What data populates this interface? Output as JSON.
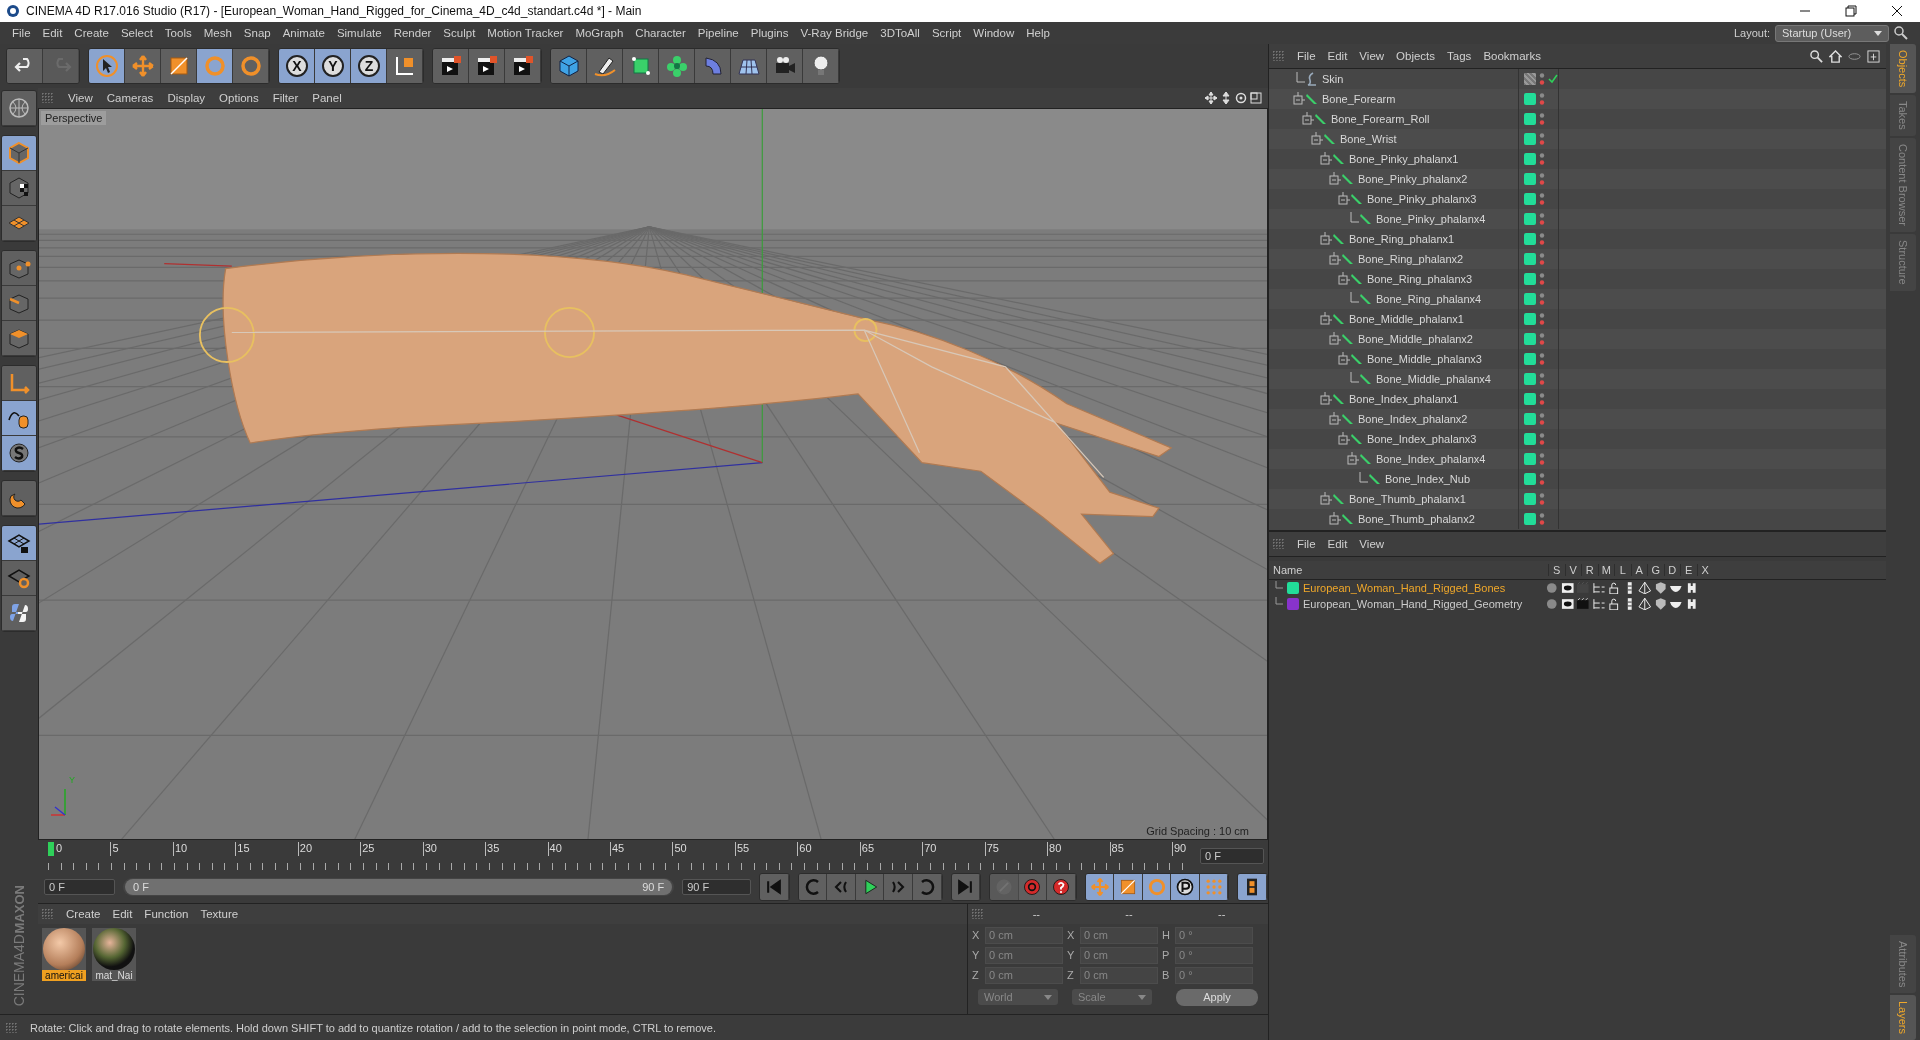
{
  "window": {
    "title": "CINEMA 4D R17.016 Studio (R17) - [European_Woman_Hand_Rigged_for_Cinema_4D_c4d_standart.c4d *] - Main"
  },
  "menu_bar": [
    "File",
    "Edit",
    "Create",
    "Select",
    "Tools",
    "Mesh",
    "Snap",
    "Animate",
    "Simulate",
    "Render",
    "Sculpt",
    "Motion Tracker",
    "MoGraph",
    "Character",
    "Pipeline",
    "Plugins",
    "V-Ray Bridge",
    "3DToAll",
    "Script",
    "Window",
    "Help"
  ],
  "layout": {
    "label": "Layout:",
    "value": "Startup (User)"
  },
  "toolbar": [
    [
      {
        "kind": "undo",
        "selected": false,
        "disabled": false
      },
      {
        "kind": "redo",
        "selected": false,
        "disabled": true
      }
    ],
    [
      {
        "kind": "cursor",
        "selected": true,
        "disabled": false
      },
      {
        "kind": "move",
        "selected": false,
        "disabled": false
      },
      {
        "kind": "scale",
        "selected": false,
        "disabled": false
      },
      {
        "kind": "rotate",
        "selected": true,
        "disabled": false
      },
      {
        "kind": "rotate",
        "selected": false,
        "disabled": false
      }
    ],
    [
      {
        "kind": "letter",
        "label": "X",
        "selected": true,
        "disabled": false
      },
      {
        "kind": "letter",
        "label": "Y",
        "selected": true,
        "disabled": false
      },
      {
        "kind": "letter",
        "label": "Z",
        "selected": true,
        "disabled": false
      },
      {
        "kind": "axes",
        "selected": false,
        "disabled": false
      }
    ],
    [
      {
        "kind": "clapper",
        "selected": false,
        "disabled": false
      },
      {
        "kind": "clapper",
        "selected": false,
        "disabled": false
      },
      {
        "kind": "clapper",
        "selected": false,
        "disabled": false
      }
    ],
    [
      {
        "kind": "cube",
        "selected": false,
        "disabled": false
      },
      {
        "kind": "pen",
        "selected": false,
        "disabled": false
      },
      {
        "kind": "greencube",
        "selected": false,
        "disabled": false
      },
      {
        "kind": "flower",
        "selected": false,
        "disabled": false
      },
      {
        "kind": "bend",
        "selected": false,
        "disabled": false
      },
      {
        "kind": "floor",
        "selected": false,
        "disabled": false
      },
      {
        "kind": "camera",
        "selected": false,
        "disabled": false
      },
      {
        "kind": "bulb",
        "selected": false,
        "disabled": false
      }
    ]
  ],
  "left_toolbar": [
    [
      {
        "kind": "globe",
        "selected": false
      }
    ],
    [
      {
        "kind": "model",
        "selected": true
      },
      {
        "kind": "checker",
        "selected": false
      },
      {
        "kind": "plane",
        "selected": false
      }
    ],
    [
      {
        "kind": "points",
        "selected": false
      },
      {
        "kind": "edges",
        "selected": false
      },
      {
        "kind": "polygons",
        "selected": false
      }
    ],
    [
      {
        "kind": "axis",
        "selected": false
      },
      {
        "kind": "tweak",
        "selected": true
      },
      {
        "kind": "snap",
        "selected": true
      }
    ],
    [
      {
        "kind": "magnet",
        "selected": false
      }
    ],
    [
      {
        "kind": "lockgrid",
        "selected": true
      },
      {
        "kind": "syncgrid",
        "selected": false
      },
      {
        "kind": "python",
        "selected": false
      }
    ]
  ],
  "brand": [
    "MAXON",
    "CINEMA4D"
  ],
  "viewport": {
    "menu": [
      "View",
      "Cameras",
      "Display",
      "Options",
      "Filter",
      "Panel"
    ],
    "camera_label": "Perspective",
    "grid_spacing": "Grid Spacing : 10 cm",
    "gizmo_label": "Y"
  },
  "timeline": {
    "labels": [
      "0",
      "5",
      "10",
      "15",
      "20",
      "25",
      "30",
      "35",
      "40",
      "45",
      "50",
      "55",
      "60",
      "65",
      "70",
      "75",
      "80",
      "85",
      "90"
    ],
    "current_frame": "0 F"
  },
  "transport": {
    "start": "0 F",
    "range_slider": {
      "start": "0 F",
      "end": "90 F",
      "level": 1
    },
    "end": "90 F",
    "buttons": [
      [
        {
          "kind": "first",
          "selected": false,
          "disabled": false
        }
      ],
      [
        {
          "kind": "prevkey",
          "selected": false,
          "disabled": false
        },
        {
          "kind": "prevframe",
          "selected": false,
          "disabled": false
        },
        {
          "kind": "play",
          "selected": false,
          "disabled": false
        },
        {
          "kind": "nextframe",
          "selected": false,
          "disabled": false
        },
        {
          "kind": "nextkey",
          "selected": false,
          "disabled": false
        }
      ],
      [
        {
          "kind": "last",
          "selected": false,
          "disabled": false
        }
      ],
      [
        {
          "kind": "record",
          "selected": false,
          "disabled": true
        },
        {
          "kind": "autokey",
          "selected": false,
          "disabled": false
        },
        {
          "kind": "help",
          "selected": false,
          "disabled": false
        }
      ],
      [
        {
          "kind": "move",
          "selected": true,
          "disabled": false
        },
        {
          "kind": "scale",
          "selected": true,
          "disabled": false
        },
        {
          "kind": "rotate",
          "selected": true,
          "disabled": false
        },
        {
          "kind": "param",
          "selected": true,
          "disabled": false
        },
        {
          "kind": "dots",
          "selected": true,
          "disabled": false
        }
      ],
      [
        {
          "kind": "film",
          "selected": true,
          "disabled": false
        }
      ]
    ]
  },
  "materials": {
    "menu": [
      "Create",
      "Edit",
      "Function",
      "Texture"
    ],
    "items": [
      {
        "name": "americai",
        "selected": true
      },
      {
        "name": "mat_Nai",
        "selected": false
      }
    ]
  },
  "coordinates": {
    "headers": [
      "--",
      "--",
      "--"
    ],
    "rows": [
      {
        "axis": "X",
        "position": "0 cm",
        "size_axis": "X",
        "size": "0 cm",
        "rot_axis": "H",
        "rotation": "0 °"
      },
      {
        "axis": "Y",
        "position": "0 cm",
        "size_axis": "Y",
        "size": "0 cm",
        "rot_axis": "P",
        "rotation": "0 °"
      },
      {
        "axis": "Z",
        "position": "0 cm",
        "size_axis": "Z",
        "size": "0 cm",
        "rot_axis": "B",
        "rotation": "0 °"
      }
    ],
    "space": "World",
    "mode": "Scale",
    "apply": "Apply"
  },
  "status_bar": "Rotate: Click and drag to rotate elements. Hold down SHIFT to add to quantize rotation / add to the selection in point mode, CTRL to remove.",
  "objects": {
    "menu": [
      "File",
      "Edit",
      "View",
      "Objects",
      "Tags",
      "Bookmarks"
    ],
    "items": [
      {
        "name": "Skin",
        "kind": "skin",
        "checked": true,
        "expanded": false
      },
      {
        "name": "Bone_Forearm",
        "kind": "bone",
        "color": "#22dd99",
        "checked": false,
        "expanded": true,
        "children": [
          {
            "name": "Bone_Forearm_Roll",
            "kind": "bone",
            "color": "#22dd99",
            "checked": false,
            "expanded": true,
            "children": [
              {
                "name": "Bone_Wrist",
                "kind": "bone",
                "color": "#22dd99",
                "checked": false,
                "expanded": true,
                "children": [
                  {
                    "name": "Bone_Pinky_phalanx1",
                    "kind": "bone",
                    "color": "#22dd99",
                    "checked": false,
                    "expanded": true,
                    "children": [
                      {
                        "name": "Bone_Pinky_phalanx2",
                        "kind": "bone",
                        "color": "#22dd99",
                        "checked": false,
                        "expanded": true,
                        "children": [
                          {
                            "name": "Bone_Pinky_phalanx3",
                            "kind": "bone",
                            "color": "#22dd99",
                            "checked": false,
                            "expanded": true,
                            "children": [
                              {
                                "name": "Bone_Pinky_phalanx4",
                                "kind": "bone",
                                "color": "#22dd99",
                                "checked": false,
                                "expanded": false
                              }
                            ]
                          }
                        ]
                      }
                    ]
                  },
                  {
                    "name": "Bone_Ring_phalanx1",
                    "kind": "bone",
                    "color": "#22dd99",
                    "checked": false,
                    "expanded": true,
                    "children": [
                      {
                        "name": "Bone_Ring_phalanx2",
                        "kind": "bone",
                        "color": "#22dd99",
                        "checked": false,
                        "expanded": true,
                        "children": [
                          {
                            "name": "Bone_Ring_phalanx3",
                            "kind": "bone",
                            "color": "#22dd99",
                            "checked": false,
                            "expanded": true,
                            "children": [
                              {
                                "name": "Bone_Ring_phalanx4",
                                "kind": "bone",
                                "color": "#22dd99",
                                "checked": false,
                                "expanded": false
                              }
                            ]
                          }
                        ]
                      }
                    ]
                  },
                  {
                    "name": "Bone_Middle_phalanx1",
                    "kind": "bone",
                    "color": "#22dd99",
                    "checked": false,
                    "expanded": true,
                    "children": [
                      {
                        "name": "Bone_Middle_phalanx2",
                        "kind": "bone",
                        "color": "#22dd99",
                        "checked": false,
                        "expanded": true,
                        "children": [
                          {
                            "name": "Bone_Middle_phalanx3",
                            "kind": "bone",
                            "color": "#22dd99",
                            "checked": false,
                            "expanded": true,
                            "children": [
                              {
                                "name": "Bone_Middle_phalanx4",
                                "kind": "bone",
                                "color": "#22dd99",
                                "checked": false,
                                "expanded": false
                              }
                            ]
                          }
                        ]
                      }
                    ]
                  },
                  {
                    "name": "Bone_Index_phalanx1",
                    "kind": "bone",
                    "color": "#22dd99",
                    "checked": false,
                    "expanded": true,
                    "children": [
                      {
                        "name": "Bone_Index_phalanx2",
                        "kind": "bone",
                        "color": "#22dd99",
                        "checked": false,
                        "expanded": true,
                        "children": [
                          {
                            "name": "Bone_Index_phalanx3",
                            "kind": "bone",
                            "color": "#22dd99",
                            "checked": false,
                            "expanded": true,
                            "children": [
                              {
                                "name": "Bone_Index_phalanx4",
                                "kind": "bone",
                                "color": "#22dd99",
                                "checked": false,
                                "expanded": true,
                                "children": [
                                  {
                                    "name": "Bone_Index_Nub",
                                    "kind": "bone",
                                    "color": "#22dd99",
                                    "checked": false,
                                    "expanded": false
                                  }
                                ]
                              }
                            ]
                          }
                        ]
                      }
                    ]
                  },
                  {
                    "name": "Bone_Thumb_phalanx1",
                    "kind": "bone",
                    "color": "#22dd99",
                    "checked": false,
                    "expanded": true,
                    "children": [
                      {
                        "name": "Bone_Thumb_phalanx2",
                        "kind": "bone",
                        "color": "#22dd99",
                        "checked": false,
                        "expanded": true
                      }
                    ]
                  }
                ]
              }
            ]
          }
        ]
      }
    ]
  },
  "layers": {
    "menu": [
      "File",
      "Edit",
      "View"
    ],
    "columns": [
      "Name",
      "S",
      "V",
      "R",
      "M",
      "L",
      "A",
      "G",
      "D",
      "E",
      "X"
    ],
    "rows": [
      {
        "name": "European_Woman_Hand_Rigged_Bones",
        "color": "#22dd99",
        "selected": true,
        "render": false
      },
      {
        "name": "European_Woman_Hand_Rigged_Geometry",
        "color": "#8833cc",
        "selected": false,
        "render": true
      }
    ]
  },
  "side_tabs_top": [
    {
      "label": "Objects",
      "selected": true
    },
    {
      "label": "Takes",
      "selected": false
    },
    {
      "label": "Content Browser",
      "selected": false
    },
    {
      "label": "Structure",
      "selected": false
    }
  ],
  "side_tabs_bottom": [
    {
      "label": "Attributes",
      "selected": false
    },
    {
      "label": "Layers",
      "selected": true
    }
  ]
}
